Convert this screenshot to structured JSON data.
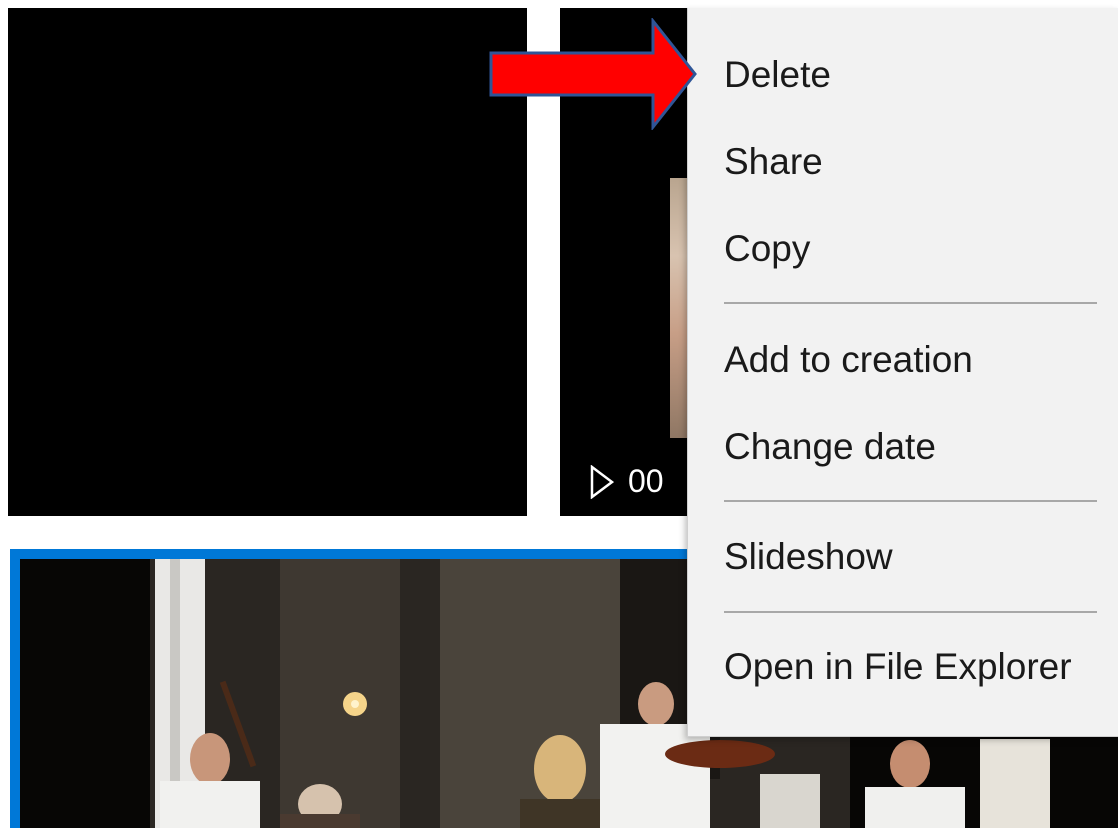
{
  "grid": {
    "tiles": [
      {
        "kind": "black-frame"
      },
      {
        "kind": "video",
        "duration_label": "00"
      },
      {
        "kind": "photo",
        "selected": true
      }
    ]
  },
  "context_menu": {
    "items": [
      {
        "label": "Delete"
      },
      {
        "label": "Share"
      },
      {
        "label": "Copy"
      },
      {
        "label": "Add to creation"
      },
      {
        "label": "Change date"
      },
      {
        "label": "Slideshow"
      },
      {
        "label": "Open in File Explorer"
      }
    ]
  },
  "annotation": {
    "arrow_color": "#ff0000",
    "arrow_outline": "#2f5597",
    "points_to": "Delete"
  },
  "colors": {
    "selection": "#0078d7",
    "menu_background": "#f2f2f2",
    "separator": "#a8a8a8"
  },
  "icons": [
    "play-icon"
  ]
}
